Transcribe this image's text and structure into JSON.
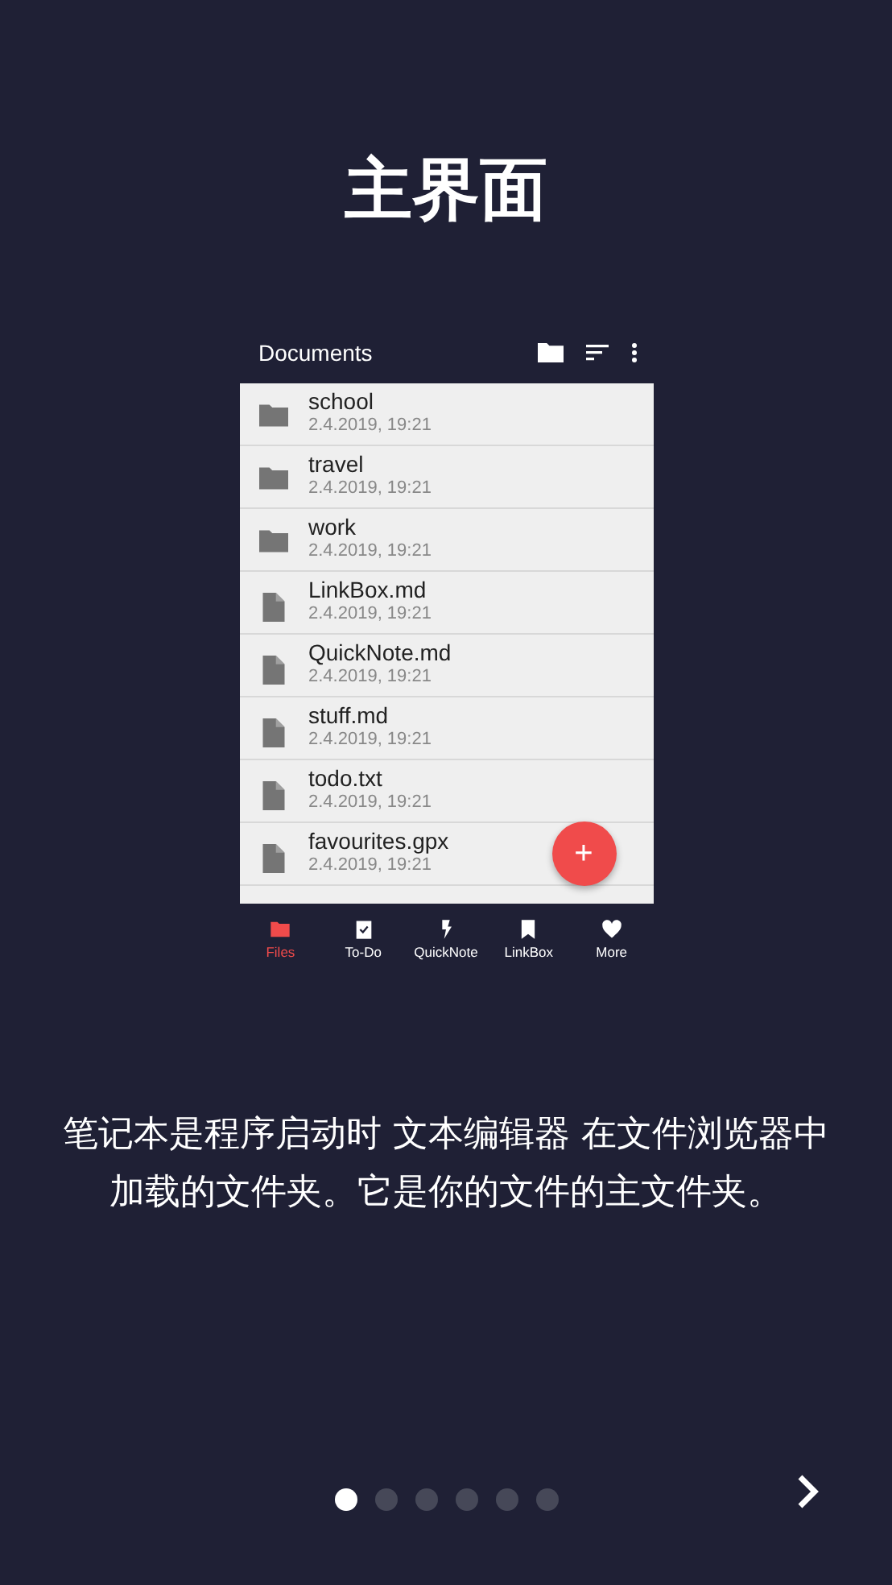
{
  "title": "主界面",
  "screenshot": {
    "toolbar": {
      "title": "Documents"
    },
    "files": [
      {
        "kind": "folder",
        "name": "school",
        "date": "2.4.2019, 19:21"
      },
      {
        "kind": "folder",
        "name": "travel",
        "date": "2.4.2019, 19:21"
      },
      {
        "kind": "folder",
        "name": "work",
        "date": "2.4.2019, 19:21"
      },
      {
        "kind": "file",
        "name": "LinkBox.md",
        "date": "2.4.2019, 19:21"
      },
      {
        "kind": "file",
        "name": "QuickNote.md",
        "date": "2.4.2019, 19:21"
      },
      {
        "kind": "file",
        "name": "stuff.md",
        "date": "2.4.2019, 19:21"
      },
      {
        "kind": "file",
        "name": "todo.txt",
        "date": "2.4.2019, 19:21"
      },
      {
        "kind": "file",
        "name": "favourites.gpx",
        "date": "2.4.2019, 19:21"
      }
    ],
    "fab": {
      "label": "+"
    },
    "nav": [
      {
        "kind": "folder",
        "label": "Files",
        "selected": true
      },
      {
        "kind": "todo",
        "label": "To-Do",
        "selected": false
      },
      {
        "kind": "bolt",
        "label": "QuickNote",
        "selected": false
      },
      {
        "kind": "bookmark",
        "label": "LinkBox",
        "selected": false
      },
      {
        "kind": "heart",
        "label": "More",
        "selected": false
      }
    ]
  },
  "description": "笔记本是程序启动时 文本编辑器 在文件浏览器中加载的文件夹。它是你的文件的主文件夹。",
  "pager": [
    {
      "selected": true
    },
    {
      "selected": false
    },
    {
      "selected": false
    },
    {
      "selected": false
    },
    {
      "selected": false
    },
    {
      "selected": false
    }
  ]
}
